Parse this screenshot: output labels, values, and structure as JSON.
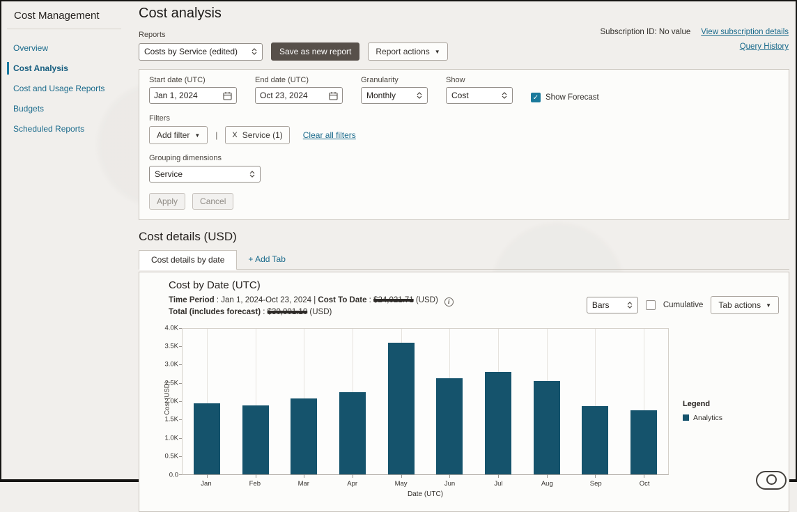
{
  "sidebar": {
    "title": "Cost Management",
    "items": [
      {
        "label": "Overview",
        "active": false
      },
      {
        "label": "Cost Analysis",
        "active": true
      },
      {
        "label": "Cost and Usage Reports",
        "active": false
      },
      {
        "label": "Budgets",
        "active": false
      },
      {
        "label": "Scheduled Reports",
        "active": false
      }
    ]
  },
  "header": {
    "title": "Cost analysis",
    "subscription_text": "Subscription ID: No value",
    "view_subscription_link": "View subscription details",
    "query_history_link": "Query History"
  },
  "reports": {
    "label": "Reports",
    "selected": "Costs by Service (edited)",
    "save_button": "Save as new report",
    "actions_button": "Report actions"
  },
  "filters_panel": {
    "start_date": {
      "label": "Start date (UTC)",
      "value": "Jan 1, 2024"
    },
    "end_date": {
      "label": "End date (UTC)",
      "value": "Oct 23, 2024"
    },
    "granularity": {
      "label": "Granularity",
      "value": "Monthly"
    },
    "show": {
      "label": "Show",
      "value": "Cost"
    },
    "show_forecast_label": "Show Forecast",
    "filters_label": "Filters",
    "add_filter_button": "Add filter",
    "pipe_separator": "|",
    "service_chip_close": "X",
    "service_chip_label": "Service (1)",
    "clear_all_link": "Clear all filters",
    "grouping_label": "Grouping dimensions",
    "grouping_value": "Service",
    "apply_button": "Apply",
    "cancel_button": "Cancel"
  },
  "cost_details": {
    "heading": "Cost details (USD)",
    "active_tab": "Cost details by date",
    "add_tab_label": "+ Add Tab"
  },
  "chart_panel": {
    "meta": {
      "time_period_label": "Time Period",
      "colon_sep": " : ",
      "time_period_value": "Jan 1, 2024-Oct 23, 2024",
      "pipe_sep": " | ",
      "cost_to_date_label": "Cost To Date",
      "cost_to_date_value": "$24,021.71",
      "usd_suffix": " (USD)",
      "info_glyph": "i",
      "total_label": "Total (includes forecast)",
      "total_value": "$30,001.10"
    },
    "chart_type_value": "Bars",
    "cumulative_label": "Cumulative",
    "tab_actions_button": "Tab actions",
    "legend_title": "Legend"
  },
  "chart_data": {
    "type": "bar",
    "title": "Cost by Date (UTC)",
    "xlabel": "Date (UTC)",
    "ylabel": "Cost (USD)",
    "categories": [
      "Jan",
      "Feb",
      "Mar",
      "Apr",
      "May",
      "Jun",
      "Jul",
      "Aug",
      "Sep",
      "Oct"
    ],
    "series": [
      {
        "name": "Analytics",
        "color": "#15536C",
        "values": [
          1930,
          1860,
          2050,
          2230,
          3570,
          2610,
          2780,
          2540,
          1850,
          1730
        ]
      }
    ],
    "ylim": [
      0,
      4000
    ],
    "ytick_labels": [
      "0.0",
      "0.5K",
      "1.0K",
      "1.5K",
      "2.0K",
      "2.5K",
      "3.0K",
      "3.5K",
      "4.0K"
    ],
    "grid": "vertical",
    "legend_position": "right"
  },
  "colors": {
    "accent_teal": "#1b7a9c",
    "link": "#1b6b8c",
    "bar": "#15536C",
    "dark_button": "#57504a"
  }
}
